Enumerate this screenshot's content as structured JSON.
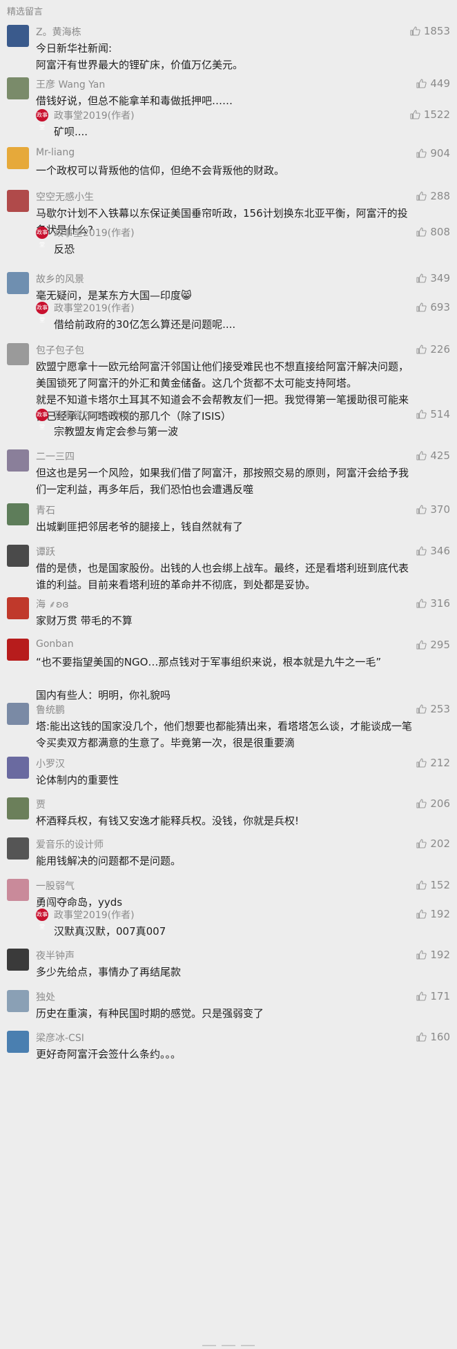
{
  "section": {
    "title": "精选留言"
  },
  "colors": {
    "background": "#ededed",
    "meta": "#8a8a8a",
    "text": "#1f1f1f",
    "reply_badge": "#c8102e"
  },
  "icons": {
    "like": "thumbs-up-icon",
    "reply_badge": "author-seal-icon"
  },
  "comments": [
    {
      "user": "Z。黄海栋",
      "text": "今日新华社新闻:\n阿富汗有世界最大的锂矿床，价值万亿美元。",
      "likes": "1853",
      "avatar_color": "#3a5a8c"
    },
    {
      "user": "王彦 Wang Yan",
      "text": "借钱好说，但总不能拿羊和毒做抵押吧……",
      "likes": "449",
      "avatar_color": "#7a8b6a",
      "reply": {
        "author": "政事堂2019(作者)",
        "text": "矿呗....",
        "likes": "1522",
        "badge": "政事堂"
      }
    },
    {
      "user": "Mr-liang",
      "text": "一个政权可以背叛他的信仰，但绝不会背叛他的财政。",
      "likes": "904",
      "avatar_color": "#e6a93a"
    },
    {
      "user": "空空无感小生",
      "text": "马歇尔计划不入铁幕以东保证美国垂帘听政，156计划换东北亚平衡，阿富汗的投\n名状是什么?",
      "likes": "288",
      "avatar_color": "#b04a4a",
      "reply": {
        "author": "政事堂2019(作者)",
        "text": "反恐",
        "likes": "808",
        "badge": "政事堂"
      }
    },
    {
      "user": "故乡的风景",
      "text": "毫无疑问，是某东方大国—印度😸",
      "likes": "349",
      "avatar_color": "#6f8fb0",
      "reply": {
        "author": "政事堂2019(作者)",
        "text": "借给前政府的30亿怎么算还是问题呢....",
        "likes": "693",
        "badge": "政事堂"
      }
    },
    {
      "user": "包子包子包",
      "text": "欧盟宁愿拿十一欧元给阿富汗邻国让他们接受难民也不想直接给阿富汗解决问题，\n美国锁死了阿富汗的外汇和黄金储备。这几个货都不太可能支持阿塔。\n就是不知道卡塔尔土耳其不知道会不会帮教友们一把。我觉得第一笔援助很可能来\n自已经承认阿塔政权的那几个（除了ISIS）",
      "likes": "226",
      "avatar_color": "#9a9a9a",
      "reply": {
        "author": "政事堂2019(作者)",
        "text": "宗教盟友肯定会参与第一波",
        "likes": "514",
        "badge": "政事堂"
      }
    },
    {
      "user": "二一三四",
      "text": "但这也是另一个风险，如果我们借了阿富汗，那按照交易的原则，阿富汗会给予我\n们一定利益，再多年后，我们恐怕也会遭遇反噬",
      "likes": "425",
      "avatar_color": "#8a7f9a"
    },
    {
      "user": "青石",
      "text": "出城剿匪把邻居老爷的腿接上，钱自然就有了",
      "likes": "370",
      "avatar_color": "#5e7d5a"
    },
    {
      "user": "谭跃",
      "text": "借的是债，也是国家股份。出钱的人也会绑上战车。最终，还是看塔利班到底代表\n谁的利益。目前来看塔利班的革命并不彻底，到处都是妥协。",
      "likes": "346",
      "avatar_color": "#4a4a4a"
    },
    {
      "user": "海 ⸙ʚɞ",
      "text": "家财万贯 带毛的不算",
      "likes": "316",
      "avatar_color": "#c0392b"
    },
    {
      "user": "Gonban",
      "text": "“也不要指望美国的NGO…那点钱对于军事组织来说，根本就是九牛之一毛”\n\n国内有些人：明明，你礼貌吗",
      "likes": "295",
      "avatar_color": "#b71c1c"
    },
    {
      "user": "鲁统鹏",
      "text": "塔:能出这钱的国家没几个，他们想要也都能猜出来，看塔塔怎么谈，才能谈成一笔\n令买卖双方都满意的生意了。毕竟第一次，很是很重要滴",
      "likes": "253",
      "avatar_color": "#7a8aa5"
    },
    {
      "user": "小罗汉",
      "text": "论体制内的重要性",
      "likes": "212",
      "avatar_color": "#6a6aa0"
    },
    {
      "user": "贾",
      "text": "杯酒释兵权，有钱又安逸才能释兵权。没钱，你就是兵权!",
      "likes": "206",
      "avatar_color": "#6b7f5a"
    },
    {
      "user": "爱音乐的设计师",
      "text": "能用钱解决的问题都不是问题。",
      "likes": "202",
      "avatar_color": "#555555"
    },
    {
      "user": "一股弱气",
      "text": "勇闯夺命岛，yyds",
      "likes": "152",
      "avatar_color": "#c98a9a",
      "reply": {
        "author": "政事堂2019(作者)",
        "text": "汉默真汉默，007真007",
        "likes": "192",
        "badge": "政事堂"
      }
    },
    {
      "user": "夜半钟声",
      "text": "多少先给点，事情办了再结尾款",
      "likes": "192",
      "avatar_color": "#3a3a3a"
    },
    {
      "user": "独处",
      "text": "历史在重演，有种民国时期的感觉。只是强弱变了",
      "likes": "171",
      "avatar_color": "#8aa0b5"
    },
    {
      "user": "梁彦冰-CSI",
      "text": "更好奇阿富汗会签什么条约。。。",
      "likes": "160",
      "avatar_color": "#4a7fb0"
    }
  ]
}
